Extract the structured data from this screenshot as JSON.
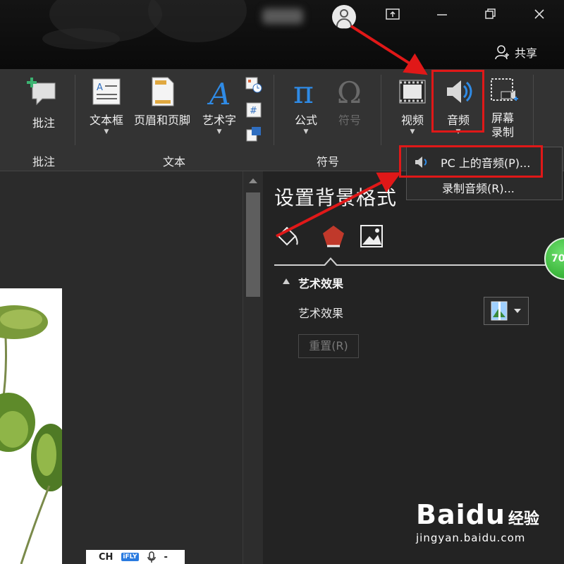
{
  "titlebar": {
    "share_label": "共享",
    "icons": [
      "user-avatar-icon",
      "ribbon-display-icon",
      "minimize-icon",
      "restore-icon",
      "close-icon",
      "share-person-icon"
    ]
  },
  "ribbon": {
    "groups": {
      "comments": "批注",
      "text": "文本",
      "symbols": "符号"
    },
    "buttons": {
      "comment": "批注",
      "textbox": "文本框",
      "header_footer": "页眉和页脚",
      "wordart": "艺术字",
      "equation": "公式",
      "symbol": "符号",
      "video": "视频",
      "audio": "音频",
      "screen_rec_1": "屏幕",
      "screen_rec_2": "录制"
    },
    "colors": {
      "highlight": "#e01818",
      "accent_blue": "#2f8be6"
    }
  },
  "audio_menu": {
    "items": [
      "PC 上的音频(P)...",
      "录制音频(R)..."
    ]
  },
  "format_pane": {
    "title": "设置背景格式",
    "section": "艺术效果",
    "art_effect_label": "艺术效果",
    "reset_button": "重置(R)",
    "tab_icons": [
      "fill-bucket-icon",
      "effects-pentagon-icon",
      "picture-icon"
    ]
  },
  "badge": {
    "value": "70"
  },
  "ime_bar": {
    "mode": "CH",
    "brand": "iFLY"
  },
  "watermark": {
    "logo": "Baidu",
    "sub": "经验",
    "url": "jingyan.baidu.com"
  }
}
